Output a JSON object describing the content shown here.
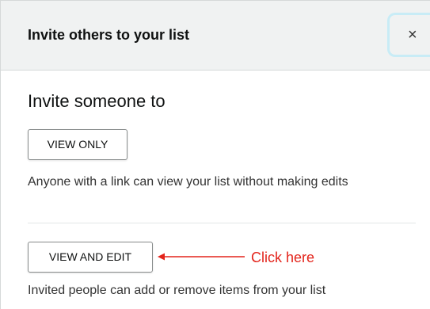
{
  "dialog": {
    "title": "Invite others to your list",
    "close_label": "×"
  },
  "invite": {
    "heading": "Invite someone to",
    "view_only": {
      "label": "VIEW ONLY",
      "description": "Anyone with a link can view your list without making edits"
    },
    "view_and_edit": {
      "label": "VIEW AND EDIT",
      "description": "Invited people can add or remove items from your list"
    }
  },
  "annotation": {
    "text": "Click here",
    "color": "#e3241b"
  },
  "colors": {
    "header_bg": "#f0f2f2",
    "close_focus_ring": "#c8ecf6",
    "button_border": "#888c8c"
  }
}
